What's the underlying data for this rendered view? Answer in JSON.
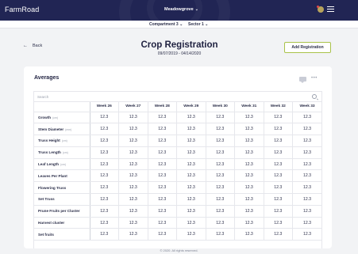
{
  "app": {
    "name": "FarmRoad",
    "location": "Meadowgrove"
  },
  "filters": {
    "compartment": "Compartment 3",
    "sector": "Sector 1"
  },
  "page": {
    "back_label": "Back",
    "title": "Crop Registration",
    "date_range": "09/07/2019 - 04/14/2020",
    "add_button": "Add Registration"
  },
  "averages": {
    "title": "Averages",
    "search_placeholder": "Search",
    "weeks": [
      "Week 26",
      "Week 27",
      "Week 28",
      "Week 29",
      "Week 30",
      "Week 31",
      "Week 32",
      "Week 33"
    ],
    "rows": [
      {
        "label": "Growth",
        "unit": "(cm)",
        "values": [
          "12.3",
          "12.3",
          "12.3",
          "12.3",
          "12.3",
          "12.3",
          "12.3",
          "12.3"
        ]
      },
      {
        "label": "Stem Diameter",
        "unit": "(mm)",
        "values": [
          "12.3",
          "12.3",
          "12.3",
          "12.3",
          "12.3",
          "12.3",
          "12.3",
          "12.3"
        ]
      },
      {
        "label": "Truss Height",
        "unit": "(cm)",
        "values": [
          "12.3",
          "12.3",
          "12.3",
          "12.3",
          "12.3",
          "12.3",
          "12.3",
          "12.3"
        ]
      },
      {
        "label": "Truss Length",
        "unit": "(cm)",
        "values": [
          "12.3",
          "12.3",
          "12.3",
          "12.3",
          "12.3",
          "12.3",
          "12.3",
          "12.3"
        ]
      },
      {
        "label": "Leaf Length",
        "unit": "(cm)",
        "values": [
          "12.3",
          "12.3",
          "12.3",
          "12.3",
          "12.3",
          "12.3",
          "12.3",
          "12.3"
        ]
      },
      {
        "label": "Leaves Per Plant",
        "unit": "",
        "values": [
          "12.3",
          "12.3",
          "12.3",
          "12.3",
          "12.3",
          "12.3",
          "12.3",
          "12.3"
        ]
      },
      {
        "label": "Flowering Truss",
        "unit": "",
        "values": [
          "12.3",
          "12.3",
          "12.3",
          "12.3",
          "12.3",
          "12.3",
          "12.3",
          "12.3"
        ]
      },
      {
        "label": "Set Truss",
        "unit": "",
        "values": [
          "12.3",
          "12.3",
          "12.3",
          "12.3",
          "12.3",
          "12.3",
          "12.3",
          "12.3"
        ]
      },
      {
        "label": "Prune Fruits per Cluster",
        "unit": "",
        "values": [
          "12.3",
          "12.3",
          "12.3",
          "12.3",
          "12.3",
          "12.3",
          "12.3",
          "12.3"
        ]
      },
      {
        "label": "Harvest cluster",
        "unit": "",
        "values": [
          "12.3",
          "12.3",
          "12.3",
          "12.3",
          "12.3",
          "12.3",
          "12.3",
          "12.3"
        ]
      },
      {
        "label": "Set fruits",
        "unit": "",
        "values": [
          "12.3",
          "12.3",
          "12.3",
          "12.3",
          "12.3",
          "12.3",
          "12.3",
          "12.3"
        ]
      }
    ]
  },
  "footer": {
    "copyright": "© 2020. All rights reserved."
  },
  "colors": {
    "nav_bg": "#212554",
    "accent_border": "#a9c24a",
    "page_bg": "#f2f3f5"
  },
  "icons": [
    "user-avatar-icon",
    "hamburger-menu-icon",
    "back-arrow-icon",
    "chat-icon",
    "more-options-icon",
    "search-icon"
  ]
}
